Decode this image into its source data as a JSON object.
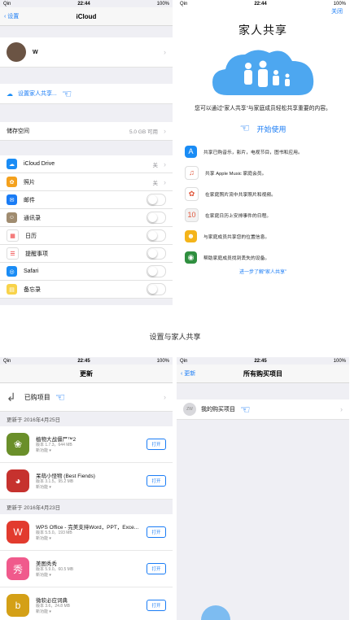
{
  "status": {
    "carrier": "Qin",
    "time1": "22:44",
    "time2": "22:45",
    "battery": "100%"
  },
  "icloud": {
    "back": "设置",
    "title": "iCloud",
    "user_initial": "W",
    "family_setup": "设置家人共享...",
    "storage_label": "储存空间",
    "storage_value": "5.0 GB 可用",
    "items": [
      {
        "label": "iCloud Drive",
        "value": "关",
        "type": "value",
        "color": "#1a8cf5",
        "glyph": "☁"
      },
      {
        "label": "照片",
        "value": "关",
        "type": "value",
        "color": "#f4a11d",
        "glyph": "✿"
      },
      {
        "label": "邮件",
        "type": "toggle",
        "color": "#1a7cf5",
        "glyph": "✉"
      },
      {
        "label": "通讯录",
        "type": "toggle",
        "color": "#a08c70",
        "glyph": "☺"
      },
      {
        "label": "日历",
        "type": "toggle",
        "color": "#ffffff",
        "glyph": "▦"
      },
      {
        "label": "提醒事项",
        "type": "toggle",
        "color": "#ffffff",
        "glyph": "☰"
      },
      {
        "label": "Safari",
        "type": "toggle",
        "color": "#1a8cf5",
        "glyph": "◎"
      },
      {
        "label": "备忘录",
        "type": "toggle",
        "color": "#f8d34a",
        "glyph": "▤"
      }
    ]
  },
  "family": {
    "close": "关闭",
    "title": "家人共享",
    "desc": "您可以通过“家人共享”与家庭成员轻松共享重要的内容。",
    "start": "开始使用",
    "features": [
      {
        "text": "共享已购音乐，影片，电视节目，图书和应用。",
        "color": "#1a8cf5",
        "glyph": "A"
      },
      {
        "text": "共享 Apple Music 家庭会员。",
        "color": "#ffffff",
        "glyph": "♫"
      },
      {
        "text": "在家庭照片流中共享照片和视频。",
        "color": "#ffffff",
        "glyph": "✿"
      },
      {
        "text": "在家庭日历上安排事件的日程。",
        "color": "#f2f2f2",
        "glyph": "10"
      },
      {
        "text": "与家庭成员共享您的位置信息。",
        "color": "#f4b41a",
        "glyph": "☻"
      },
      {
        "text": "帮助家庭成员找到丢失的设备。",
        "color": "#2f8f3f",
        "glyph": "◉"
      }
    ],
    "bottom_link": "进一步了解“家人共享”"
  },
  "caption": "设置与家人共享",
  "updates": {
    "title": "更新",
    "purchased": "已购项目",
    "section1": "更新于 2016年4月25日",
    "section2": "更新于 2016年4月23日",
    "open": "打开",
    "apps": [
      {
        "name": "植物大战僵尸™2",
        "sub1": "版本 1.7.3，644 MB",
        "sub2": "新功能 ▾",
        "color": "#6a8f2a",
        "glyph": "❀",
        "section": 1
      },
      {
        "name": "呆萌小怪物 (Best Fiends)",
        "sub1": "版本 3.1.5，95.2 MB",
        "sub2": "新功能 ▾",
        "color": "#c6322e",
        "glyph": "◕",
        "section": 1
      },
      {
        "name": "WPS Office - 完美支持Word，PPT，Exce...",
        "sub1": "版本 5.5.0，193 MB",
        "sub2": "新功能 ▾",
        "color": "#e23b2e",
        "glyph": "W",
        "section": 2
      },
      {
        "name": "美图秀秀",
        "sub1": "版本 5.9.0，60.5 MB",
        "sub2": "新功能 ▾",
        "color": "#f05a8c",
        "glyph": "秀",
        "section": 2
      },
      {
        "name": "微软必应词典",
        "sub1": "版本 3.6，24.8 MB",
        "sub2": "新功能 ▾",
        "color": "#d4a017",
        "glyph": "b",
        "section": 2
      }
    ]
  },
  "purchased": {
    "back": "更新",
    "title": "所有购买项目",
    "avatar": "ZW",
    "mine": "我的购买项目"
  }
}
